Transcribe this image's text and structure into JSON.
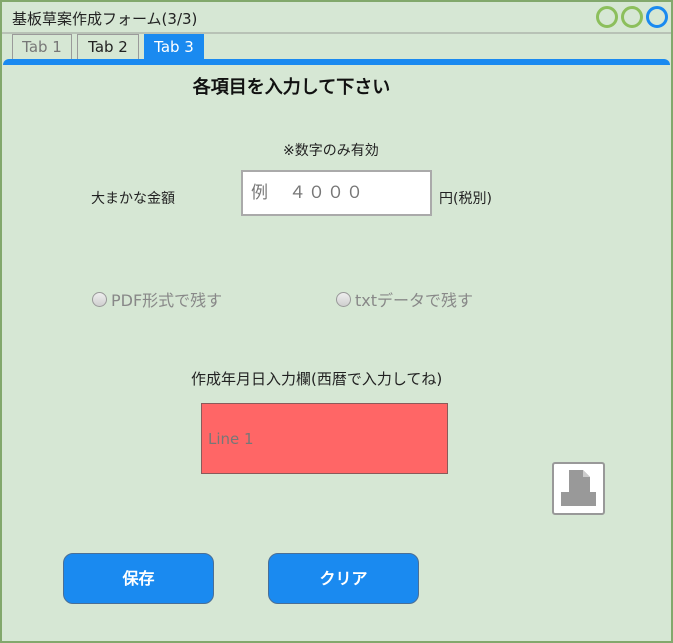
{
  "window": {
    "title": "基板草案作成フォーム(3/3)"
  },
  "tabs": [
    {
      "label": "Tab 1",
      "active": false
    },
    {
      "label": "Tab 2",
      "active": false
    },
    {
      "label": "Tab 3",
      "active": true
    }
  ],
  "form": {
    "heading": "各項目を入力して下さい",
    "note": "※数字のみ有効",
    "amount_label": "大まかな金額",
    "amount_placeholder": "例　４０００",
    "amount_unit": "円(税別)",
    "radio_pdf": "PDF形式で残す",
    "radio_txt": "txtデータで残す",
    "date_label": "作成年月日入力欄(西暦で入力してね)",
    "date_value": "Line 1"
  },
  "buttons": {
    "save": "保存",
    "clear": "クリア"
  },
  "colors": {
    "background": "#d6e7d4",
    "accent": "#1a8af0",
    "date_box": "#ff6666",
    "window_border": "#82a86c"
  },
  "icons": {
    "file": "document-save-icon"
  }
}
